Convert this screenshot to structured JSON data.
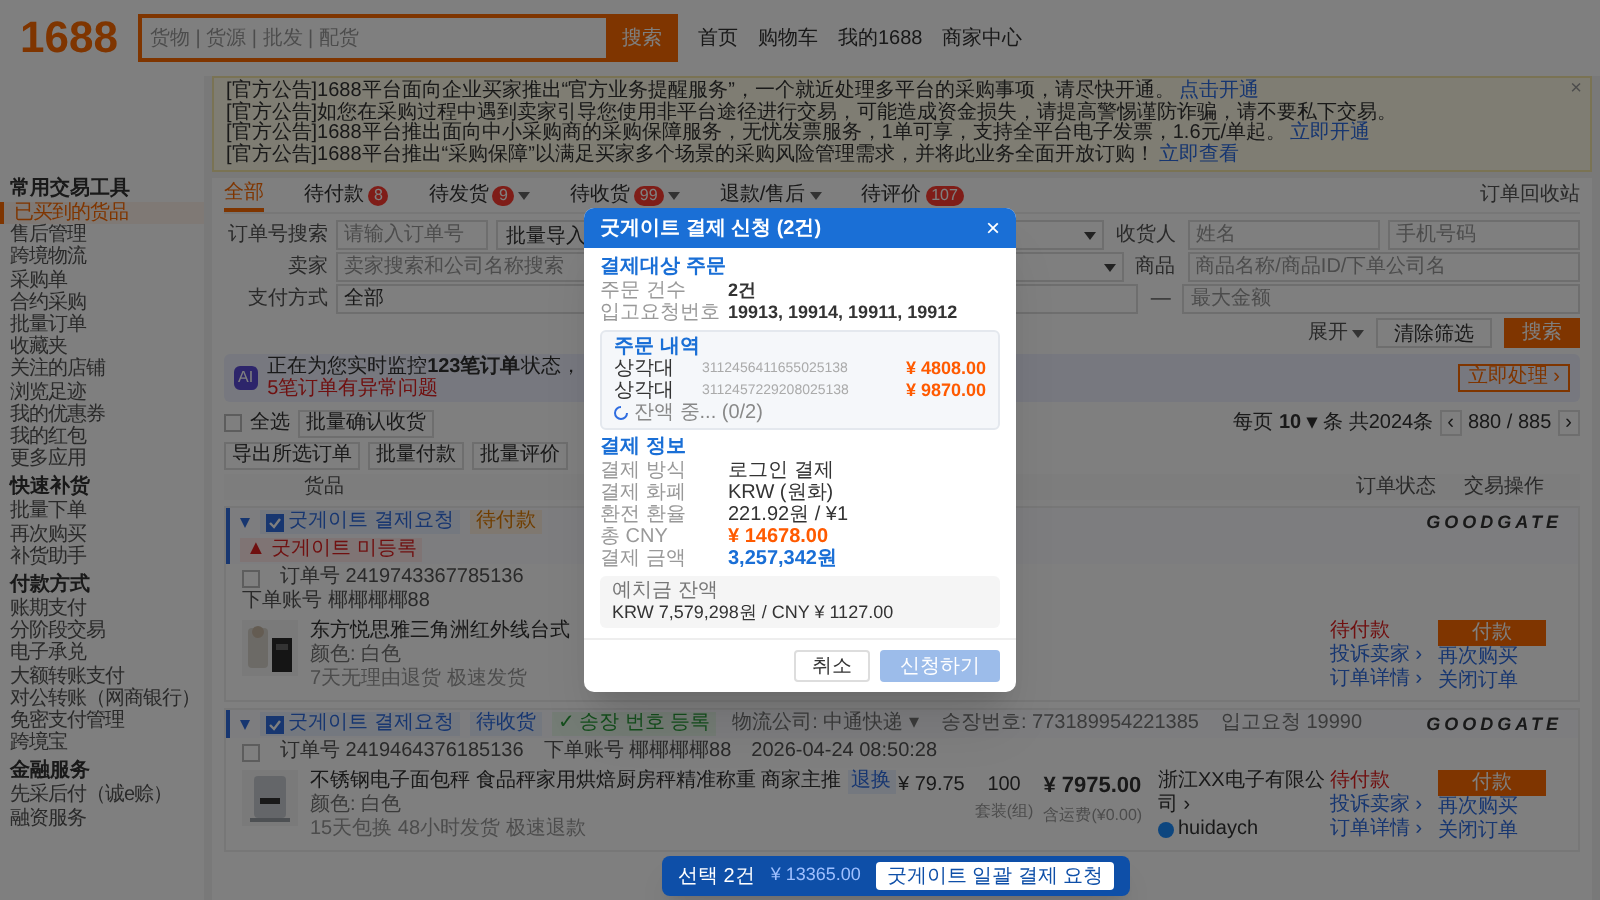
{
  "header": {
    "logo": "1688",
    "search_placeholder": "货物 | 货源 | 批发 | 配货",
    "search_button": "搜索",
    "nav": [
      "首页",
      "购物车",
      "我的1688",
      "商家中心"
    ]
  },
  "notices": [
    {
      "tag": "[官方公告]",
      "text": "1688平台面向企业买家推出“官方业务提醒服务”，一个就近处理多平台的采购事项，请尽快开通。",
      "link": "点击开通"
    },
    {
      "tag": "[官方公告]",
      "text": "如您在采购过程中遇到卖家引导您使用非平台途径进行交易，可能造成资金损失，请提高警惕谨防诈骗，请不要私下交易。"
    },
    {
      "tag": "[官方公告]",
      "text": "1688平台推出面向中小采购商的采购保障服务，无忧发票服务，1单可享，支持全平台电子发票，1.6元/单起。",
      "link": "立即开通"
    },
    {
      "tag": "[官方公告]",
      "text": "1688平台推出“采购保障”以满足买家多个场景的采购风险管理需求，并将此业务全面开放订购！",
      "link": "立即查看"
    }
  ],
  "notice_close": "×",
  "sidebar": [
    {
      "title": "常用交易工具",
      "items": [
        {
          "label": "已买到的货品",
          "selected": true
        },
        {
          "label": "售后管理",
          "selected": false
        },
        {
          "label": "跨境物流",
          "selected": false
        },
        {
          "label": "采购单",
          "selected": false
        },
        {
          "label": "合约采购",
          "selected": false
        },
        {
          "label": "批量订单",
          "selected": false
        },
        {
          "label": "收藏夹",
          "selected": false
        },
        {
          "label": "关注的店铺",
          "selected": false
        },
        {
          "label": "浏览足迹",
          "selected": false
        },
        {
          "label": "我的优惠券",
          "selected": false
        },
        {
          "label": "我的红包",
          "selected": false
        },
        {
          "label": "更多应用",
          "selected": false
        }
      ]
    },
    {
      "title": "快速补货",
      "items": [
        {
          "label": "批量下单",
          "selected": false
        },
        {
          "label": "再次购买",
          "selected": false
        },
        {
          "label": "补货助手",
          "selected": false
        }
      ]
    },
    {
      "title": "付款方式",
      "items": [
        {
          "label": "账期支付",
          "selected": false
        },
        {
          "label": "分阶段交易",
          "selected": false
        },
        {
          "label": "电子承兑",
          "selected": false
        },
        {
          "label": "大额转账支付",
          "selected": false
        },
        {
          "label": "对公转账（网商银行）",
          "selected": false
        },
        {
          "label": "免密支付管理",
          "selected": false
        },
        {
          "label": "跨境宝",
          "selected": false
        }
      ]
    },
    {
      "title": "金融服务",
      "items": [
        {
          "label": "先采后付（诚e赊）",
          "selected": false
        },
        {
          "label": "融资服务",
          "selected": false
        }
      ]
    }
  ],
  "tabs": [
    {
      "label": "全部",
      "selected": true,
      "dropdown": false
    },
    {
      "label": "待付款",
      "badge": "8",
      "selected": false,
      "dropdown": false
    },
    {
      "label": "待发货",
      "badge": "9",
      "dropdown": true,
      "selected": false
    },
    {
      "label": "待收货",
      "badge": "99",
      "dropdown": true,
      "selected": false
    },
    {
      "label": "退款/售后",
      "dropdown": true,
      "selected": false
    },
    {
      "label": "待评价",
      "badge": "107",
      "selected": false,
      "dropdown": false
    }
  ],
  "recycle_bin": "订单回收站",
  "filters": [
    [
      {
        "kind": "label",
        "text": "订单号搜索"
      },
      {
        "kind": "input",
        "placeholder": "请输入订单号"
      },
      {
        "kind": "button",
        "text": "批量导入"
      },
      {
        "kind": "select"
      },
      {
        "kind": "label",
        "text": "收货人"
      },
      {
        "kind": "input",
        "placeholder": "姓名"
      },
      {
        "kind": "input",
        "placeholder": "手机号码"
      }
    ],
    [
      {
        "kind": "label",
        "text": "卖家"
      },
      {
        "kind": "input",
        "placeholder": "卖家搜索和公司名称搜索"
      },
      {
        "kind": "select"
      },
      {
        "kind": "label",
        "text": "商品"
      },
      {
        "kind": "input",
        "placeholder": "商品名称/商品ID/下单公司名"
      }
    ],
    [
      {
        "kind": "label",
        "text": "支付方式"
      },
      {
        "kind": "input",
        "value": "全部"
      },
      {
        "kind": "input"
      },
      {
        "kind": "label",
        "text": "—"
      },
      {
        "kind": "input",
        "placeholder": "最大金额"
      }
    ]
  ],
  "filter_actions": {
    "expand": "展开",
    "clear": "清除筛选",
    "search": "搜索"
  },
  "banner": {
    "badge": "AI",
    "text": "正在为您实时监控**123笔订单**状态，",
    "alert": "5笔订单有异常问题",
    "button": "立即处理 ›"
  },
  "toolbar": {
    "select_all": "全选",
    "select_all_checked": false,
    "buttons": [
      "批量确认收货",
      "导出所选订单",
      "批量付款",
      "批量评价"
    ],
    "per_page": "每页",
    "page_size": "10 ▾",
    "unit": "条",
    "total": "共2024条",
    "prev": "‹",
    "page": "880 / 885",
    "next": "›"
  },
  "columns": [
    "货品",
    "订单状态",
    "交易操作"
  ],
  "orders": [
    {
      "checked": false,
      "tags": [
        {
          "kind": "check",
          "text": "굿게이트 결제요청",
          "checked": true
        },
        {
          "kind": "orange",
          "text": "待付款"
        },
        {
          "kind": "warn",
          "text": "▲ 굿게이트 미등록"
        }
      ],
      "brand": "GOODGATE",
      "order_no": "订单号 2419743367785136",
      "account": "下单账号 椰椰椰椰88",
      "title": "东方悦思雅三角洲红外线台式",
      "spec": "颜色: 白色",
      "meta": "7天无理由退货 极速发货",
      "status": "待付款",
      "status_links": [
        "投诉卖家 ›",
        "订单详情 ›"
      ],
      "pay": "付款",
      "actions": [
        "再次购买",
        "关闭订单"
      ]
    },
    {
      "checked": false,
      "tags": [
        {
          "kind": "check",
          "text": "굿게이트 결제요청",
          "checked": true
        },
        {
          "kind": "blue",
          "text": "待收货"
        },
        {
          "kind": "ok",
          "text": "✓ 송장 번호 등록"
        },
        {
          "kind": "text",
          "text": "物流公司: 中通快递 ▾"
        },
        {
          "kind": "text",
          "text": "송장번호: 773189954221385"
        },
        {
          "kind": "text",
          "text": "입고요청 19990"
        }
      ],
      "brand": "GOODGATE",
      "order_no": "订单号 2419464376185136",
      "account": "下单账号 椰椰椰椰88",
      "time": "2026-04-24 08:50:28",
      "title": "不锈钢电子面包秤 食品秤家用烘焙厨房秤精准称重 商家主推",
      "title_tag": "退换",
      "spec": "颜色: 白色",
      "meta": "15天包换 48小时发货 极速退款",
      "price": "¥ 79.75",
      "qty": "100",
      "qty_unit": "套装(组)",
      "total": "¥ 7975.00",
      "total_note": "含运费(¥0.00)",
      "seller": "浙江XX电子有限公司 ›",
      "seller_id": "huidaych",
      "status": "待付款",
      "status_links": [
        "投诉卖家 ›",
        "订单详情 ›"
      ],
      "pay": "付款",
      "actions": [
        "再次购买",
        "关闭订单"
      ]
    }
  ],
  "modal": {
    "title": "굿게이트 결제 신청 (2건)",
    "close": "×",
    "target_heading": "결제대상 주문",
    "target_rows": [
      {
        "label": "주문 건수",
        "value": "2건"
      },
      {
        "label": "입고요청번호",
        "value": "19913, 19914, 19911, 19912"
      }
    ],
    "detail_heading": "주문 내역",
    "details": [
      {
        "name": "상각대",
        "order": "3112456411655025138",
        "amount": "¥ 4808.00"
      },
      {
        "name": "상각대",
        "order": "3112457229208025138",
        "amount": "¥ 9870.00"
      }
    ],
    "loading": "잔액 중... (0/2)",
    "pay_heading": "결제 정보",
    "pay_rows": [
      {
        "label": "결제 방식",
        "value": "로그인 결제",
        "kind": "plain"
      },
      {
        "label": "결제 화폐",
        "value": "KRW (원화)",
        "kind": "plain"
      },
      {
        "label": "환전 환율",
        "value": "221.92원 / ¥1",
        "kind": "plain"
      },
      {
        "label": "총 CNY",
        "value": "¥ 14678.00",
        "kind": "cny"
      },
      {
        "label": "결제 금액",
        "value": "3,257,342원",
        "kind": "krw"
      }
    ],
    "balance_label": "예치금 잔액",
    "balance": "KRW 7,579,298원 / CNY ¥ 1127.00",
    "cancel": "취소",
    "submit": "신청하기",
    "submit_disabled": true
  },
  "floating_bar": {
    "count": "선택 2건",
    "amount": "¥ 13365.00",
    "button": "굿게이트 일괄 결제 요청"
  }
}
